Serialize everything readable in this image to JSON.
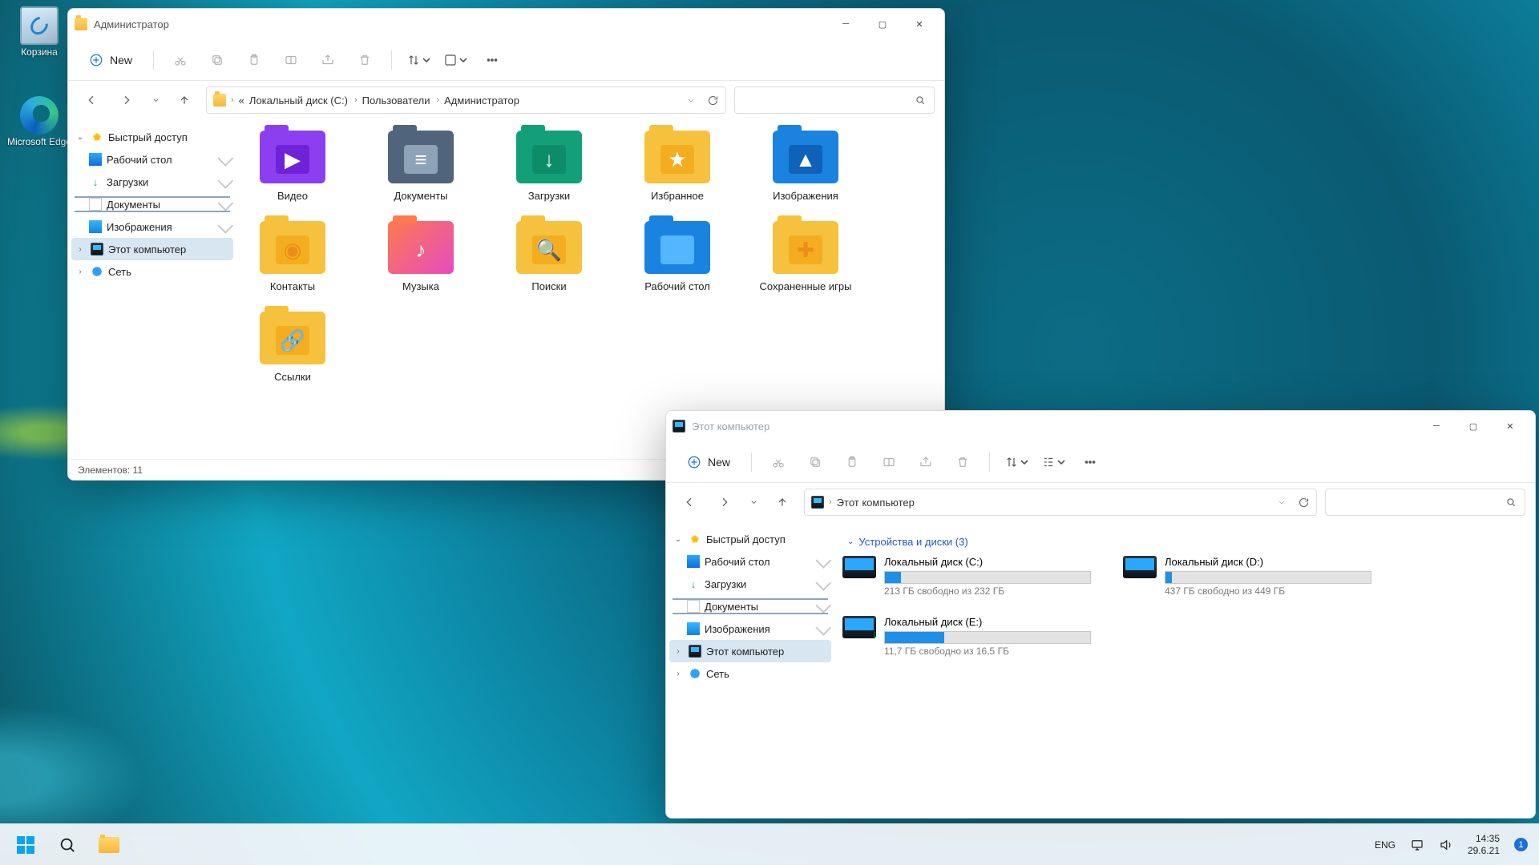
{
  "desktop": {
    "recycle": "Корзина",
    "edge": "Microsoft Edge"
  },
  "win1": {
    "title": "Администратор",
    "new": "New",
    "crumbs": [
      "Локальный диск (C:)",
      "Пользователи",
      "Администратор"
    ],
    "crumb_prefix": "«",
    "side": {
      "quick": "Быстрый доступ",
      "desktop": "Рабочий стол",
      "downloads": "Загрузки",
      "docs": "Документы",
      "pics": "Изображения",
      "thispc": "Этот компьютер",
      "net": "Сеть"
    },
    "folders": [
      "Видео",
      "Документы",
      "Загрузки",
      "Избранное",
      "Изображения",
      "Контакты",
      "Музыка",
      "Поиски",
      "Рабочий стол",
      "Сохраненные игры",
      "Ссылки"
    ],
    "folder_styles": [
      {
        "bg": "#8b3ff0",
        "inner": "#6f22d8",
        "glyph": "▶",
        "gc": "#ffffff"
      },
      {
        "bg": "#50647b",
        "inner": "#8ea2b8",
        "glyph": "≡",
        "gc": "#ffffff"
      },
      {
        "bg": "#12a079",
        "inner": "#0c8d68",
        "glyph": "↓",
        "gc": "#ffffff"
      },
      {
        "bg": "#f6c13c",
        "inner": "#f4ad1e",
        "glyph": "★",
        "gc": "#ffffff"
      },
      {
        "bg": "#1a83e0",
        "inner": "#0e63b8",
        "glyph": "▲",
        "gc": "#ffffff"
      },
      {
        "bg": "#f6c13c",
        "inner": "#f4ad1e",
        "glyph": "◉",
        "gc": "#ec8c1a"
      },
      {
        "bg": "linear-gradient(135deg,#ff7a4d,#e44cc0)",
        "inner": "transparent",
        "glyph": "♪",
        "gc": "#ffffff"
      },
      {
        "bg": "#f6c13c",
        "inner": "#f4ad1e",
        "glyph": "🔍",
        "gc": "#ec8c1a"
      },
      {
        "bg": "#1a83e0",
        "inner": "#54b6ff",
        "glyph": "",
        "gc": ""
      },
      {
        "bg": "#f6c13c",
        "inner": "#f4ad1e",
        "glyph": "✚",
        "gc": "#ec8c1a"
      },
      {
        "bg": "#f6c13c",
        "inner": "#f4ad1e",
        "glyph": "🔗",
        "gc": "#ec8c1a"
      }
    ],
    "status": "Элементов: 11"
  },
  "win2": {
    "title": "Этот компьютер",
    "new": "New",
    "addr": "Этот компьютер",
    "side": {
      "quick": "Быстрый доступ",
      "desktop": "Рабочий стол",
      "downloads": "Загрузки",
      "docs": "Документы",
      "pics": "Изображения",
      "thispc": "Этот компьютер",
      "net": "Сеть"
    },
    "section": "Устройства и диски (3)",
    "drives": [
      {
        "name": "Локальный диск (C:)",
        "sub": "213 ГБ свободно из 232 ГБ",
        "fill": 8
      },
      {
        "name": "Локальный диск (D:)",
        "sub": "437 ГБ свободно из 449 ГБ",
        "fill": 3
      },
      {
        "name": "Локальный диск (E:)",
        "sub": "11,7 ГБ свободно из 16,5 ГБ",
        "fill": 29
      }
    ]
  },
  "taskbar": {
    "lang": "ENG",
    "time": "14:35",
    "date": "29.6.21",
    "badge": "1"
  }
}
